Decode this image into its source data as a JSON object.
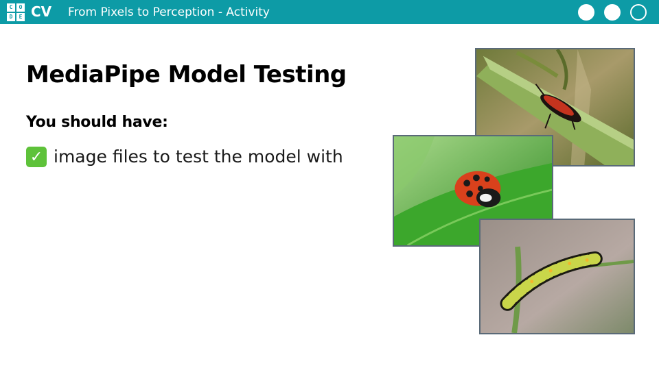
{
  "header": {
    "logo_letters": [
      "C",
      "O",
      "D",
      "E"
    ],
    "brand": "CV",
    "deck_title": "From Pixels to Perception - Activity",
    "nav_dots": [
      "filled",
      "filled",
      "outline"
    ],
    "bar_color": "#0d9ba6"
  },
  "slide": {
    "title": "MediaPipe Model Testing",
    "subtitle": "You should have:",
    "check_icon": "white-heavy-check-mark-icon",
    "check_symbol": "✓",
    "check_text": "image files to test the model with"
  },
  "images": [
    {
      "subject": "boxelder-bug-icon"
    },
    {
      "subject": "ladybug-icon"
    },
    {
      "subject": "caterpillar-icon"
    }
  ]
}
